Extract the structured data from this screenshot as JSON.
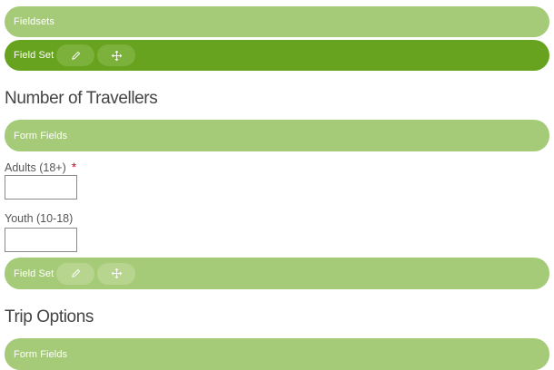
{
  "fieldsets_bar": {
    "label": "Fieldsets"
  },
  "fieldset_1": {
    "label": "Field Set",
    "edit_icon": "pencil-icon",
    "move_icon": "move-icon"
  },
  "travellers": {
    "title": "Number of Travellers",
    "form_fields_label": "Form Fields",
    "adults": {
      "label": "Adults (18+)",
      "required_marker": "*",
      "value": ""
    },
    "youth": {
      "label": "Youth (10-18)",
      "value": ""
    }
  },
  "fieldset_2": {
    "label": "Field Set",
    "edit_icon": "pencil-icon",
    "move_icon": "move-icon"
  },
  "trip_options": {
    "title": "Trip Options",
    "form_fields_label": "Form Fields"
  },
  "colors": {
    "green_light": "#a6cb78",
    "green_dark": "#67a31e",
    "required": "#c8102e"
  }
}
